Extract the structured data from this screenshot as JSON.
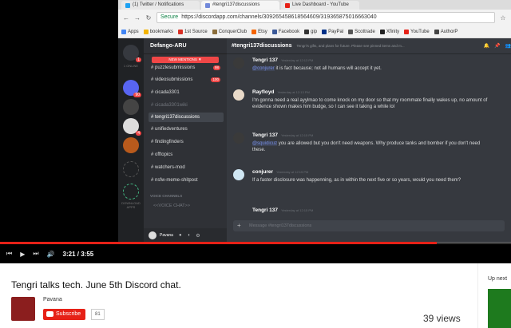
{
  "browser": {
    "tabs": [
      {
        "label": "(1) Twitter / Notifications",
        "color": "#1da1f2"
      },
      {
        "label": "#tengri137discussions",
        "color": "#7289da"
      },
      {
        "label": "Live Dashboard - YouTube",
        "color": "#e62117"
      }
    ],
    "secure_label": "Secure",
    "url": "https://discordapp.com/channels/309265458618564609/319365875016663040",
    "bookmarks": [
      {
        "label": "Apps",
        "color": "#4285f4"
      },
      {
        "label": "bookmarks",
        "color": "#f4b400"
      },
      {
        "label": "1st Source",
        "color": "#d93025"
      },
      {
        "label": "ConquerClub",
        "color": "#8a6d3b"
      },
      {
        "label": "Etsy",
        "color": "#f56400"
      },
      {
        "label": "Facebook",
        "color": "#3b5998"
      },
      {
        "label": "gip",
        "color": "#333333"
      },
      {
        "label": "PayPal",
        "color": "#003087"
      },
      {
        "label": "Scottrade",
        "color": "#555555"
      },
      {
        "label": "Xfinity",
        "color": "#222222"
      },
      {
        "label": "YouTube",
        "color": "#e62117"
      },
      {
        "label": "AuthorP",
        "color": "#444444"
      }
    ]
  },
  "discord": {
    "guild_labels": [
      "1 ONLINE",
      "DOWNLOAD APPS"
    ],
    "guild_badges": [
      "1",
      "90",
      "4"
    ],
    "server_name": "Defango-ARU",
    "new_mentions": "NEW MENTIONS ▼",
    "channels": [
      {
        "label": "# puzzlesubmissions",
        "badge": "98"
      },
      {
        "label": "# videosubmissions",
        "badge": "100"
      },
      {
        "label": "# cicada3301",
        "badge": ""
      },
      {
        "label": "# cicada3301wiki",
        "badge": ""
      },
      {
        "label": "# tengri137discussions",
        "badge": ""
      },
      {
        "label": "# unifiedventures",
        "badge": ""
      },
      {
        "label": "# findingfinders",
        "badge": ""
      },
      {
        "label": "# offtopics",
        "badge": ""
      },
      {
        "label": "# watchers-mod",
        "badge": ""
      },
      {
        "label": "# nsfw-meme-shitpost",
        "badge": ""
      }
    ],
    "voice_header": "VOICE CHANNELS",
    "voice_channel": "<<VOICE CHAT>>",
    "user_name": "Pavana",
    "channel_title": "#tengri137discussions",
    "channel_topic": "Tengri's gifts, and plans for future. Please see pinned items and m...",
    "messages": [
      {
        "author": "Tengri 137",
        "time": "Yesterday at 12:13 PM",
        "mention": "@conjurer",
        "text": " it is fact because; not all humans will accept it yet.",
        "avatar_color": "#3a3a3a"
      },
      {
        "author": "Rayfloyd",
        "time": "Yesterday at 12:13 PM",
        "mention": "",
        "text": "I'm gonna need a real ayylmao to come knock on my door so that my roommate finally wakes up, no amount of evidence shown makes him budge, so I can see it taking a while lol",
        "avatar_color": "#e8d9c8"
      },
      {
        "author": "Tengri 137",
        "time": "Yesterday at 12:15 PM",
        "mention": "@squidicuz",
        "text": " you are allowed but you don't need weapons. Why produce tanks and bomber if you don't need these.",
        "avatar_color": "#3a3a3a"
      },
      {
        "author": "conjurer",
        "time": "Yesterday at 12:15 PM",
        "mention": "",
        "text": "If a faster disclosure was happenning, as in within the next five or so years, would you need them?",
        "avatar_color": "#cfe6f2"
      },
      {
        "author": "Tengri 137",
        "time": "Yesterday at 12:15 PM",
        "mention": "",
        "text": "",
        "avatar_color": "#3a3a3a"
      }
    ],
    "composer_placeholder": "Message #tengri137discussions"
  },
  "player": {
    "current_time": "3:21 / 3:55",
    "progress": 0.855
  },
  "video": {
    "title": "Tengri talks tech. June 5th Discord chat.",
    "channel_name": "Pavana",
    "subscribe_label": "Subscribe",
    "subscriber_count": "81",
    "views": "39 views",
    "up_next_label": "Up next"
  }
}
